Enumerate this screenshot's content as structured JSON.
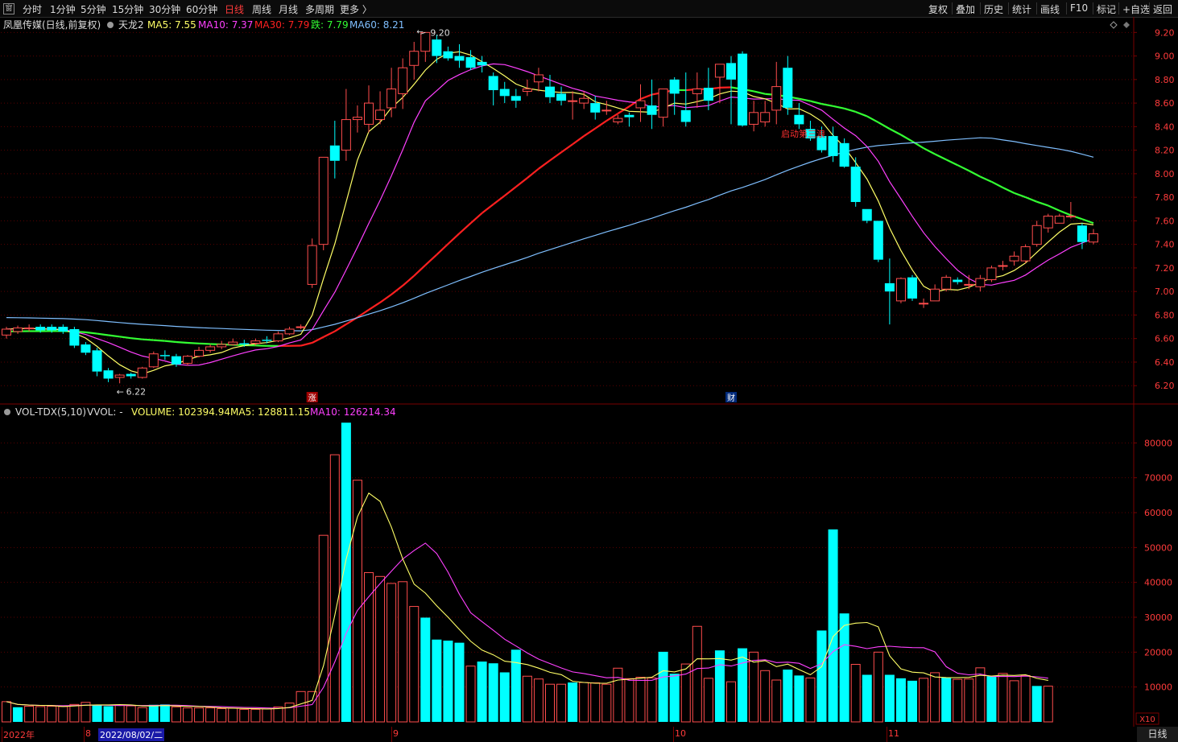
{
  "toolbar": {
    "window_icon": "窗",
    "periods": [
      "分时",
      "1分钟",
      "5分钟",
      "15分钟",
      "30分钟",
      "60分钟",
      "日线",
      "周线",
      "月线",
      "多周期",
      "更多 〉"
    ],
    "active_period": "日线",
    "right_buttons": [
      "复权",
      "叠加",
      "历史",
      "统计",
      "画线",
      "F10",
      "标记",
      "+自选",
      "返回"
    ]
  },
  "price_legend": {
    "stock_name": "凤凰传媒(日线,前复权)",
    "indicator": "天龙2",
    "ma5": "MA5: 7.55",
    "ma10": "MA10: 7.37",
    "ma30": "MA30: 7.79",
    "die": "跌: 7.79",
    "ma60": "MA60: 8.21"
  },
  "volume_legend": {
    "name": "VOL-TDX(5,10)",
    "vvol": "VVOL: -",
    "volume": "VOLUME: 102394.94",
    "ma5": "MA5: 128811.15",
    "ma10": "MA10: 126214.34"
  },
  "annotations": {
    "high_label": "9.20",
    "low_label": "6.22",
    "zhang_marker": "涨",
    "cai_marker": "财",
    "signal_text": "启动第三浪"
  },
  "bottom_axis": {
    "labels": [
      "2022年",
      "8",
      "9",
      "10",
      "11"
    ],
    "cursor_date": "2022/08/02/二",
    "vol_multiplier": "X10",
    "period_label": "日线"
  },
  "colors": {
    "up": "#ff4d4d",
    "down": "#00ffff",
    "ma5": "#ffff66",
    "ma10": "#ff40ff",
    "ma30": "#ff2020",
    "die": "#33ff33",
    "ma60": "#7fbfff",
    "axis_text": "#ff3b3b",
    "grid": "#5a0000"
  },
  "chart_data": [
    {
      "type": "candlestick",
      "title": "凤凰传媒(日线,前复权)",
      "y_ticks": [
        "6.20",
        "6.40",
        "6.60",
        "6.80",
        "7.00",
        "7.20",
        "7.40",
        "7.60",
        "7.80",
        "8.00",
        "8.20",
        "8.40",
        "8.60",
        "8.80",
        "9.00",
        "9.20"
      ],
      "ylim": [
        6.14,
        9.25
      ],
      "high": 9.2,
      "low": 6.22,
      "candles": [
        [
          6.63,
          6.68,
          6.7,
          6.6
        ],
        [
          6.66,
          6.69,
          6.71,
          6.64
        ],
        [
          6.69,
          6.69,
          6.72,
          6.66
        ],
        [
          6.7,
          6.67,
          6.72,
          6.65
        ],
        [
          6.7,
          6.67,
          6.72,
          6.65
        ],
        [
          6.7,
          6.66,
          6.72,
          6.64
        ],
        [
          6.68,
          6.54,
          6.7,
          6.52
        ],
        [
          6.55,
          6.48,
          6.57,
          6.46
        ],
        [
          6.5,
          6.32,
          6.52,
          6.28
        ],
        [
          6.33,
          6.26,
          6.35,
          6.23
        ],
        [
          6.27,
          6.29,
          6.3,
          6.22
        ],
        [
          6.3,
          6.28,
          6.31,
          6.26
        ],
        [
          6.27,
          6.35,
          6.36,
          6.26
        ],
        [
          6.36,
          6.47,
          6.49,
          6.35
        ],
        [
          6.46,
          6.45,
          6.5,
          6.42
        ],
        [
          6.45,
          6.38,
          6.47,
          6.36
        ],
        [
          6.39,
          6.45,
          6.46,
          6.37
        ],
        [
          6.45,
          6.5,
          6.53,
          6.44
        ],
        [
          6.5,
          6.53,
          6.55,
          6.48
        ],
        [
          6.53,
          6.55,
          6.58,
          6.51
        ],
        [
          6.55,
          6.57,
          6.6,
          6.54
        ],
        [
          6.56,
          6.55,
          6.59,
          6.53
        ],
        [
          6.56,
          6.58,
          6.6,
          6.54
        ],
        [
          6.59,
          6.58,
          6.62,
          6.56
        ],
        [
          6.58,
          6.64,
          6.66,
          6.57
        ],
        [
          6.64,
          6.68,
          6.7,
          6.63
        ],
        [
          6.7,
          6.7,
          6.72,
          6.68
        ],
        [
          7.06,
          7.39,
          7.45,
          7.03
        ],
        [
          7.4,
          8.14,
          8.14,
          7.35
        ],
        [
          8.24,
          8.11,
          8.45,
          7.96
        ],
        [
          8.2,
          8.46,
          8.72,
          8.11
        ],
        [
          8.46,
          8.48,
          8.58,
          8.35
        ],
        [
          8.42,
          8.6,
          8.75,
          8.35
        ],
        [
          8.46,
          8.54,
          8.7,
          8.42
        ],
        [
          8.56,
          8.72,
          8.9,
          8.48
        ],
        [
          8.68,
          8.9,
          8.98,
          8.55
        ],
        [
          8.92,
          9.04,
          9.12,
          8.8
        ],
        [
          9.04,
          9.2,
          9.2,
          8.95
        ],
        [
          9.14,
          9.0,
          9.18,
          8.94
        ],
        [
          9.04,
          8.98,
          9.08,
          8.96
        ],
        [
          9.0,
          8.96,
          9.1,
          8.9
        ],
        [
          8.99,
          8.9,
          9.05,
          8.88
        ],
        [
          8.95,
          8.92,
          9.0,
          8.86
        ],
        [
          8.83,
          8.71,
          8.86,
          8.58
        ],
        [
          8.72,
          8.66,
          8.78,
          8.6
        ],
        [
          8.66,
          8.62,
          8.72,
          8.56
        ],
        [
          8.7,
          8.72,
          8.8,
          8.66
        ],
        [
          8.78,
          8.84,
          8.9,
          8.7
        ],
        [
          8.74,
          8.65,
          8.84,
          8.6
        ],
        [
          8.68,
          8.62,
          8.74,
          8.58
        ],
        [
          8.62,
          8.62,
          8.7,
          8.46
        ],
        [
          8.6,
          8.64,
          8.7,
          8.55
        ],
        [
          8.6,
          8.52,
          8.66,
          8.46
        ],
        [
          8.54,
          8.54,
          8.62,
          8.5
        ],
        [
          8.44,
          8.47,
          8.5,
          8.42
        ],
        [
          8.5,
          8.48,
          8.52,
          8.4
        ],
        [
          8.56,
          8.62,
          8.76,
          8.44
        ],
        [
          8.58,
          8.5,
          8.8,
          8.38
        ],
        [
          8.48,
          8.72,
          8.7,
          8.4
        ],
        [
          8.8,
          8.68,
          8.82,
          8.5
        ],
        [
          8.54,
          8.44,
          8.86,
          8.4
        ],
        [
          8.68,
          8.72,
          8.86,
          8.56
        ],
        [
          8.73,
          8.62,
          8.9,
          8.54
        ],
        [
          8.82,
          8.93,
          8.76,
          8.6
        ],
        [
          8.94,
          8.8,
          9.0,
          8.42
        ],
        [
          9.02,
          8.41,
          9.04,
          8.4
        ],
        [
          8.42,
          8.52,
          8.62,
          8.36
        ],
        [
          8.44,
          8.52,
          8.62,
          8.4
        ],
        [
          8.54,
          8.74,
          8.95,
          8.42
        ],
        [
          8.9,
          8.56,
          9.0,
          8.5
        ],
        [
          8.5,
          8.42,
          8.6,
          8.38
        ],
        [
          8.38,
          8.3,
          8.45,
          8.28
        ],
        [
          8.32,
          8.2,
          8.4,
          8.18
        ],
        [
          8.32,
          8.15,
          8.4,
          8.1
        ],
        [
          8.26,
          8.06,
          8.3,
          8.05
        ],
        [
          8.06,
          7.76,
          8.14,
          7.72
        ],
        [
          7.7,
          7.6,
          7.7,
          7.58
        ],
        [
          7.6,
          7.27,
          7.6,
          7.25
        ],
        [
          7.07,
          7.0,
          7.28,
          6.72
        ],
        [
          6.92,
          7.11,
          7.12,
          6.9
        ],
        [
          7.12,
          6.94,
          7.14,
          6.92
        ],
        [
          6.9,
          6.9,
          6.94,
          6.86
        ],
        [
          6.92,
          7.02,
          7.06,
          6.92
        ],
        [
          7.02,
          7.12,
          7.14,
          7.0
        ],
        [
          7.1,
          7.08,
          7.12,
          7.06
        ],
        [
          7.06,
          7.06,
          7.14,
          7.02
        ],
        [
          7.04,
          7.11,
          7.14,
          7.0
        ],
        [
          7.1,
          7.2,
          7.22,
          7.08
        ],
        [
          7.22,
          7.22,
          7.26,
          7.18
        ],
        [
          7.26,
          7.3,
          7.34,
          7.22
        ],
        [
          7.26,
          7.38,
          7.4,
          7.24
        ],
        [
          7.4,
          7.56,
          7.6,
          7.38
        ],
        [
          7.54,
          7.64,
          7.66,
          7.5
        ],
        [
          7.58,
          7.64,
          7.66,
          7.6
        ],
        [
          7.64,
          7.64,
          7.76,
          7.62
        ],
        [
          7.56,
          7.42,
          7.58,
          7.36
        ],
        [
          7.42,
          7.49,
          7.53,
          7.4
        ]
      ]
    },
    {
      "type": "bar",
      "title": "VOL-TDX(5,10)",
      "y_ticks": [
        "10000",
        "20000",
        "30000",
        "40000",
        "50000",
        "60000",
        "70000",
        "80000"
      ],
      "ylim": [
        0,
        87000
      ],
      "up": [
        true,
        false,
        true,
        true,
        true,
        true,
        true,
        true,
        false,
        false,
        true,
        true,
        true,
        false,
        false,
        true,
        true,
        true,
        true,
        true,
        true,
        true,
        true,
        true,
        true,
        true,
        true,
        true,
        true,
        true,
        false,
        true,
        true,
        true,
        true,
        true,
        true,
        false,
        false,
        false,
        false,
        true,
        false,
        false,
        false,
        false,
        true,
        true,
        true,
        true,
        false,
        true,
        true,
        true,
        true,
        true,
        true,
        true,
        false,
        false,
        true,
        true,
        true,
        false,
        true,
        false,
        true,
        true,
        true,
        false,
        false,
        true,
        false,
        false,
        false,
        true,
        false,
        true,
        false,
        false,
        false,
        true,
        true,
        false,
        true,
        true,
        true,
        false,
        true,
        true,
        true,
        false,
        true,
        true,
        false,
        false,
        true
      ],
      "volume": [
        5800,
        4200,
        4500,
        4400,
        4500,
        4400,
        5000,
        5600,
        4900,
        4500,
        4800,
        4600,
        4100,
        4900,
        5000,
        4300,
        4000,
        4000,
        4000,
        3800,
        3900,
        3600,
        3600,
        3700,
        4300,
        5400,
        8700,
        8700,
        53500,
        76600,
        85800,
        69300,
        42800,
        41700,
        39700,
        40200,
        33100,
        29900,
        23600,
        23300,
        22700,
        16000,
        17300,
        16800,
        14200,
        20700,
        13100,
        12300,
        10800,
        10800,
        11300,
        11300,
        11200,
        10800,
        15400,
        12400,
        12800,
        12600,
        20100,
        13800,
        16600,
        27400,
        12500,
        20500,
        11500,
        21100,
        20000,
        14700,
        12000,
        15000,
        13300,
        12600,
        26200,
        55200,
        31100,
        16500,
        13500,
        20000,
        13500,
        12500,
        11800,
        12500,
        14100,
        12700,
        12200,
        12300,
        15500,
        13100,
        13900,
        11800,
        13300,
        10300,
        10238
      ]
    }
  ]
}
